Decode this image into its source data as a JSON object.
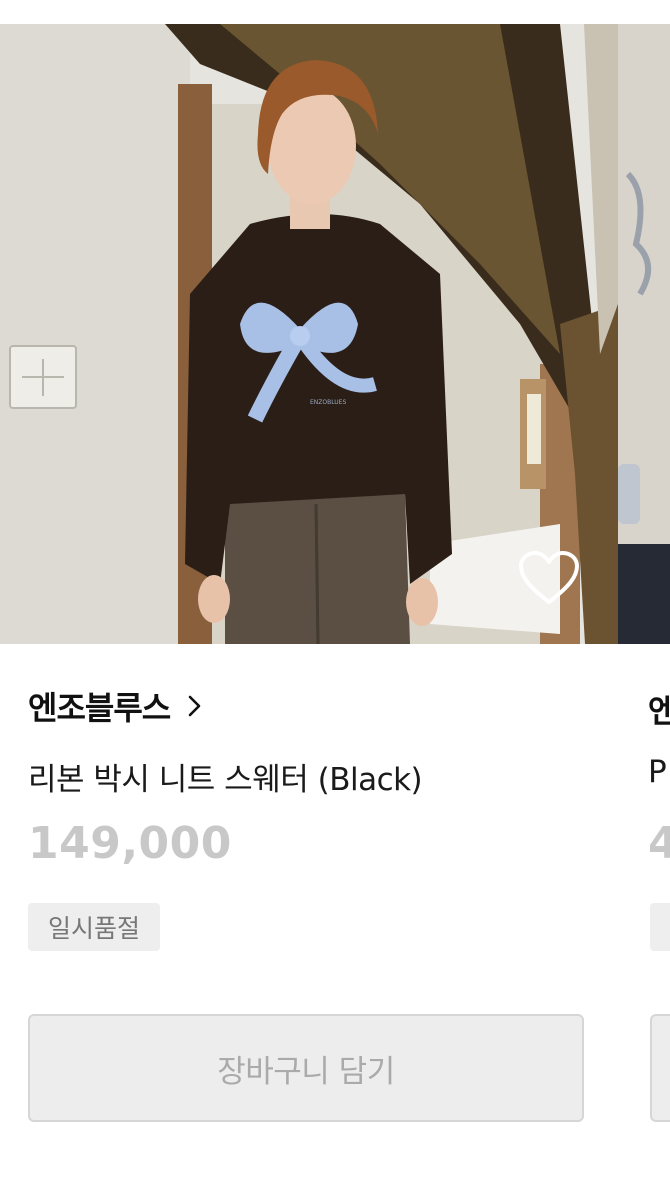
{
  "product": {
    "brand": "엔조블루스",
    "name": "리본 박시 니트 스웨터 (Black)",
    "price": "149,000",
    "status_badge": "일시품절",
    "add_to_cart_label": "장바구니 담기",
    "wishlisted": false,
    "sweater_print_text": "ENZOBLUES"
  },
  "next_card_peek": {
    "brand_fragment": "엔",
    "name_fragment": "P",
    "price_fragment": "4"
  },
  "icons": {
    "wishlist": "heart-outline-icon",
    "brand_link": "chevron-right-icon"
  },
  "colors": {
    "brand_text": "#111111",
    "price_soldout": "#c8c8c8",
    "badge_bg": "#eeeeee",
    "button_disabled_bg": "#ededed"
  }
}
